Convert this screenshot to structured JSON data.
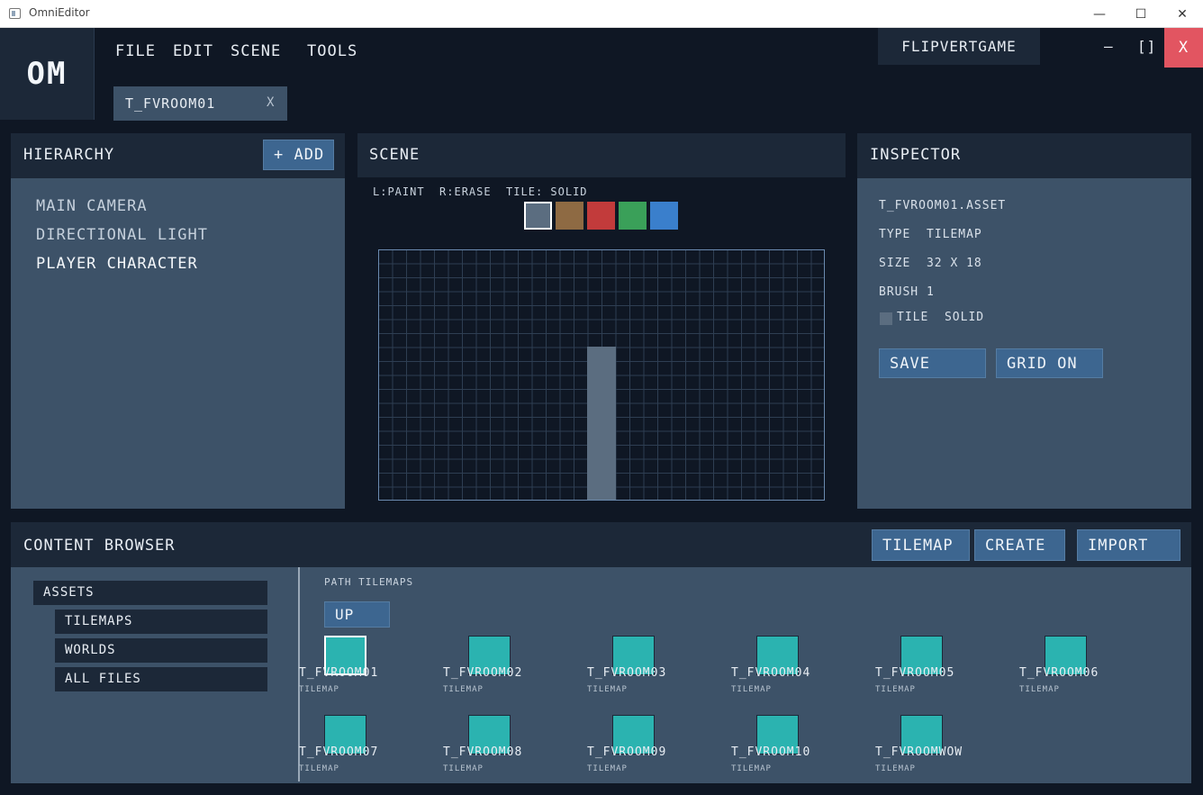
{
  "window": {
    "title": "OmniEditor",
    "controls": {
      "minimize": "—",
      "maximize": "☐",
      "close": "✕"
    }
  },
  "app": {
    "logo": "OM",
    "menu": [
      "FILE",
      "EDIT",
      "SCENE",
      "TOOLS"
    ],
    "open_tab": {
      "label": "T_FVROOM01",
      "close": "X"
    },
    "project": "FLIPVERTGAME",
    "controls": {
      "minimize": "–",
      "maximize": "[]",
      "close": "X"
    }
  },
  "hierarchy": {
    "title": "HIERARCHY",
    "add_label": "+ ADD",
    "items": [
      "MAIN CAMERA",
      "DIRECTIONAL LIGHT",
      "PLAYER CHARACTER"
    ]
  },
  "scene": {
    "title": "SCENE",
    "hint": "L:PAINT  R:ERASE  TILE: SOLID",
    "palette": [
      {
        "name": "solid",
        "color": "#5b6d80",
        "selected": true
      },
      {
        "name": "brown",
        "color": "#8e6a43",
        "selected": false
      },
      {
        "name": "red",
        "color": "#c23b3b",
        "selected": false
      },
      {
        "name": "green",
        "color": "#3aa059",
        "selected": false
      },
      {
        "name": "blue",
        "color": "#3a7fcc",
        "selected": false
      }
    ],
    "grid": {
      "cols": 32,
      "rows": 18
    }
  },
  "inspector": {
    "title": "INSPECTOR",
    "asset": "T_FVROOM01.ASSET",
    "type": "TYPE  TILEMAP",
    "size": "SIZE  32 X 18",
    "brush": "BRUSH 1",
    "tile": "TILE  SOLID",
    "save_label": "SAVE",
    "grid_label": "GRID ON"
  },
  "content_browser": {
    "title": "CONTENT BROWSER",
    "actions": [
      "TILEMAP",
      "CREATE",
      "IMPORT"
    ],
    "tree": {
      "root": "ASSETS",
      "children": [
        "TILEMAPS",
        "WORLDS",
        "ALL FILES"
      ]
    },
    "path": "PATH TILEMAPS",
    "up_label": "UP",
    "assets": [
      {
        "name": "T_FVROOM01",
        "type": "TILEMAP",
        "selected": true
      },
      {
        "name": "T_FVROOM02",
        "type": "TILEMAP"
      },
      {
        "name": "T_FVROOM03",
        "type": "TILEMAP"
      },
      {
        "name": "T_FVROOM04",
        "type": "TILEMAP"
      },
      {
        "name": "T_FVROOM05",
        "type": "TILEMAP"
      },
      {
        "name": "T_FVROOM06",
        "type": "TILEMAP"
      },
      {
        "name": "T_FVROOM07",
        "type": "TILEMAP"
      },
      {
        "name": "T_FVROOM08",
        "type": "TILEMAP"
      },
      {
        "name": "T_FVROOM09",
        "type": "TILEMAP"
      },
      {
        "name": "T_FVROOM10",
        "type": "TILEMAP"
      },
      {
        "name": "T_FVROOMWOW",
        "type": "TILEMAP"
      }
    ]
  }
}
